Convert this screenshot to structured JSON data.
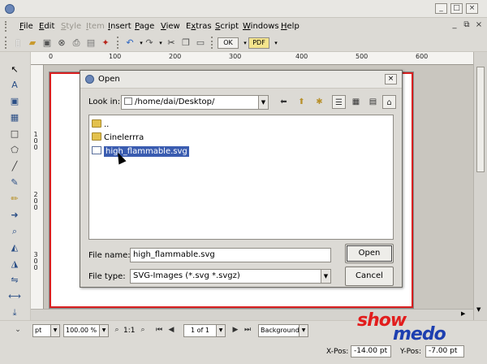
{
  "window": {
    "menus": [
      {
        "label": "File",
        "underline": "F",
        "enabled": true
      },
      {
        "label": "Edit",
        "underline": "E",
        "enabled": true
      },
      {
        "label": "Style",
        "underline": "S",
        "enabled": false
      },
      {
        "label": "Item",
        "underline": "I",
        "enabled": false
      },
      {
        "label": "Insert",
        "underline": "I",
        "enabled": true
      },
      {
        "label": "Page",
        "underline": "P",
        "enabled": true
      },
      {
        "label": "View",
        "underline": "V",
        "enabled": true
      },
      {
        "label": "Extras",
        "underline": "x",
        "enabled": true
      },
      {
        "label": "Script",
        "underline": "S",
        "enabled": true
      },
      {
        "label": "Windows",
        "underline": "W",
        "enabled": true
      },
      {
        "label": "Help",
        "underline": "H",
        "enabled": true
      }
    ],
    "toolbar": {
      "preview_badge": "OK",
      "pdf_badge": "PDF"
    },
    "ruler": {
      "top_labels": [
        "0",
        "100",
        "200",
        "300",
        "400",
        "500",
        "600"
      ],
      "left_labels": [
        "1\n0\n0",
        "2\n0\n0",
        "3\n0\n0"
      ]
    }
  },
  "dialog": {
    "title": "Open",
    "look_in_label": "Look in:",
    "look_in_path": "/home/dai/Desktop/",
    "files": [
      {
        "name": "..",
        "type": "folder",
        "selected": false
      },
      {
        "name": "Cinelerrra",
        "type": "folder",
        "selected": false
      },
      {
        "name": "high_flammable.svg",
        "type": "svg",
        "selected": true
      }
    ],
    "file_name_label": "File name:",
    "file_name_value": "high_flammable.svg",
    "file_type_label": "File type:",
    "file_type_value": "SVG-Images (*.svg *.svgz)",
    "open_button": "Open",
    "cancel_button": "Cancel"
  },
  "statusbar": {
    "unit": "pt",
    "zoom": "100.00 %",
    "ratio": "1:1",
    "page_indicator": "1 of 1",
    "layer": "Background",
    "xpos_label": "X-Pos:",
    "xpos_value": "-14.00 pt",
    "ypos_label": "Y-Pos:",
    "ypos_value": "-7.00 pt"
  },
  "watermark": {
    "part1": "show",
    "part2": "medo"
  },
  "colors": {
    "margin_red": "#d81f1f",
    "selection_blue": "#3a5cb0",
    "watermark_red": "#e21d1d",
    "watermark_blue": "#1d3fb0"
  }
}
